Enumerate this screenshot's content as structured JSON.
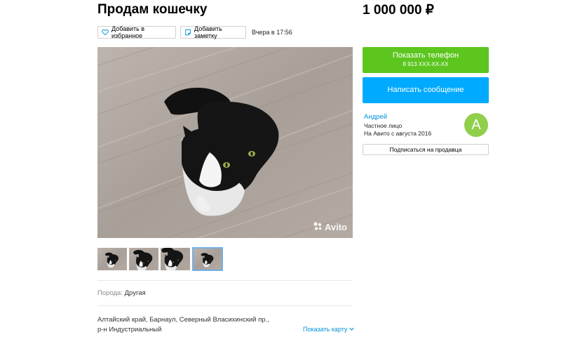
{
  "listing": {
    "title": "Продам кошечку",
    "price": "1 000 000 ₽",
    "favorite_label": "Добавить в избранное",
    "note_label": "Добавить заметку",
    "posted": "Вчера в 17:56",
    "watermark": "Avito",
    "breed_label": "Порода:",
    "breed_value": "Другая",
    "address_line1": "Алтайский край, Барнаул, Северный Власихинский пр.,",
    "address_line2": "р-н Индустриальный",
    "show_map": "Показать карту",
    "thumbnails": [
      {
        "active": false
      },
      {
        "active": false
      },
      {
        "active": false
      },
      {
        "active": true
      }
    ]
  },
  "actions": {
    "phone_label": "Показать телефон",
    "phone_number": "8 913 XXX-XX-XX",
    "message_label": "Написать сообщение",
    "subscribe_label": "Подписаться на продавца"
  },
  "seller": {
    "name": "Андрей",
    "type": "Частное лицо",
    "since": "На Авито с августа 2016",
    "avatar_letter": "А"
  },
  "colors": {
    "phone_button": "#5cc61e",
    "message_button": "#00aaff",
    "link": "#0091d9",
    "avatar": "#8fcf4a"
  },
  "icons": [
    "heart-icon",
    "note-icon",
    "chevron-down-icon",
    "avito-logo-icon"
  ]
}
